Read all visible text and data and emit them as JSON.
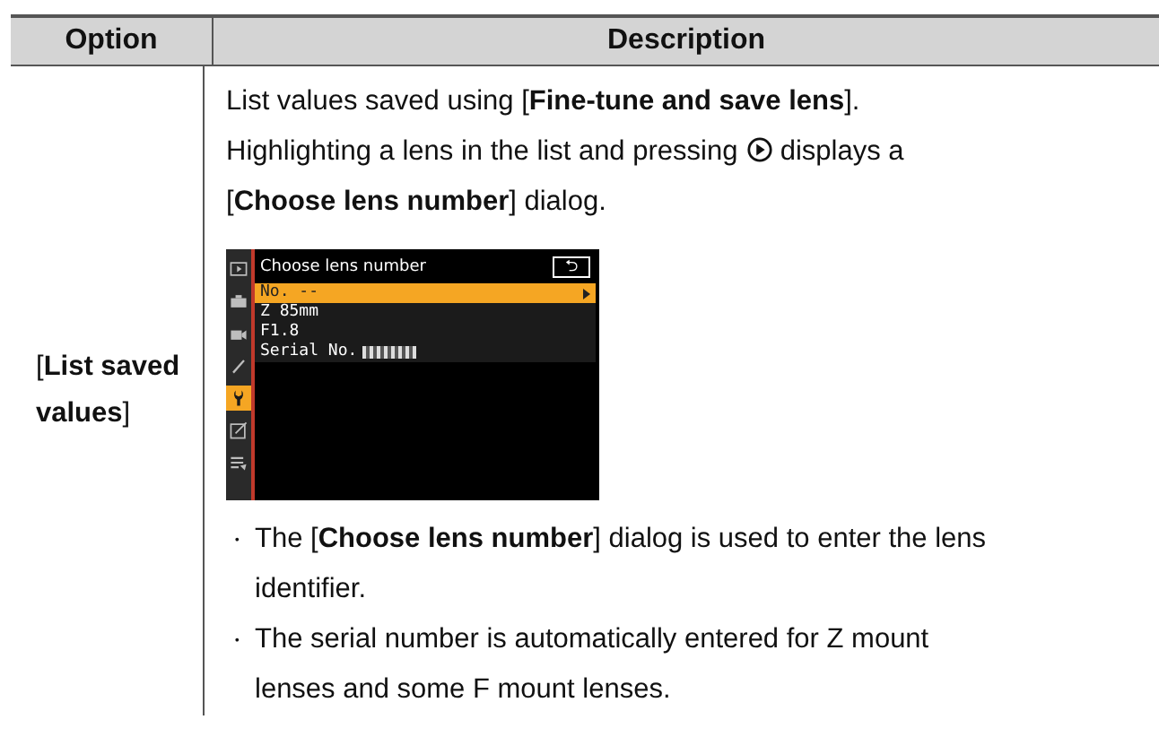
{
  "table": {
    "columns": [
      "Option",
      "Description"
    ],
    "rows": [
      {
        "option": "[**List saved values**]",
        "intro": [
          "List values saved using [**Fine-tune and save lens**].",
          "Highlighting a lens in the list and pressing",
          "displays a",
          "[**Choose lens number**] dialog."
        ],
        "screen": {
          "title": "Choose lens number",
          "back": "⮌",
          "tabs": [
            {
              "kind": "playback",
              "selected": false
            },
            {
              "kind": "photo",
              "selected": false
            },
            {
              "kind": "movie",
              "selected": false
            },
            {
              "kind": "custom",
              "selected": false
            },
            {
              "kind": "setup",
              "selected": true
            },
            {
              "kind": "retouch",
              "selected": false
            },
            {
              "kind": "mymenu",
              "selected": false
            }
          ],
          "items": [
            {
              "label": "No. --",
              "selected": true
            },
            {
              "label": "Z 85mm",
              "selected": false
            },
            {
              "label": "F1.8",
              "selected": false
            },
            {
              "label": "Serial No.",
              "selected": false,
              "blurred": true
            }
          ]
        },
        "bullets": [
          "The [**Choose lens number**] dialog is used to enter the lens identifier.",
          "The serial number is automatically entered for Z mount lenses and some F mount lenses."
        ],
        "bullet_mark": "・"
      }
    ]
  }
}
